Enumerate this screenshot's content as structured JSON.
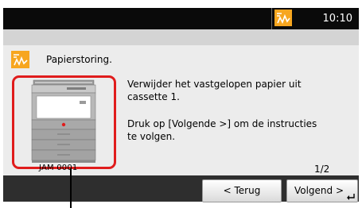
{
  "status_bar": {
    "time": "10:10",
    "alert_icon": "jam-alert-icon"
  },
  "message": {
    "icon": "jam-alert-icon",
    "title": "Papierstoring.",
    "line1": "Verwijder het vastgelopen papier uit cassette 1.",
    "line2": "Druk op [Volgende >] om de instructies te volgen.",
    "code": "JAM 0001",
    "page": "1/2"
  },
  "buttons": {
    "back": "< Terug",
    "next": "Volgend >"
  },
  "colors": {
    "alert": "#f7a61f",
    "highlight_frame": "#e01c1c",
    "status_bar": "#0a0a0a",
    "bottom_bar": "#2e2e2e"
  }
}
